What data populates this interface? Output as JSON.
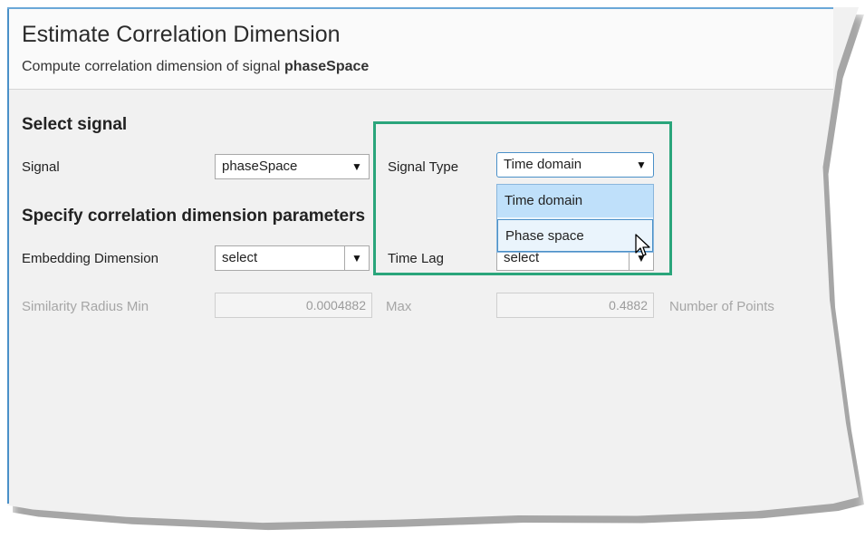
{
  "header": {
    "title": "Estimate Correlation Dimension",
    "subtitle_prefix": "Compute correlation dimension of signal ",
    "subtitle_signal": "phaseSpace"
  },
  "select_signal": {
    "heading": "Select signal",
    "signal_label": "Signal",
    "signal_value": "phaseSpace",
    "signal_type_label": "Signal Type",
    "signal_type_value": "Time domain",
    "signal_type_options": [
      "Time domain",
      "Phase space"
    ]
  },
  "params": {
    "heading": "Specify correlation dimension parameters",
    "embedding_label": "Embedding Dimension",
    "embedding_value": "select",
    "time_lag_label": "Time Lag",
    "time_lag_value": "select",
    "radius_min_label": "Similarity Radius Min",
    "radius_min_value": "0.0004882",
    "max_label": "Max",
    "max_value": "0.4882",
    "num_points_label": "Number of Points"
  },
  "colors": {
    "highlight": "#2aa57b",
    "menu_selected": "#bfe0fa",
    "menu_border": "#4a90c8"
  },
  "icons": {
    "dropdown": "triangle-down",
    "cursor": "pointer-arrow"
  }
}
